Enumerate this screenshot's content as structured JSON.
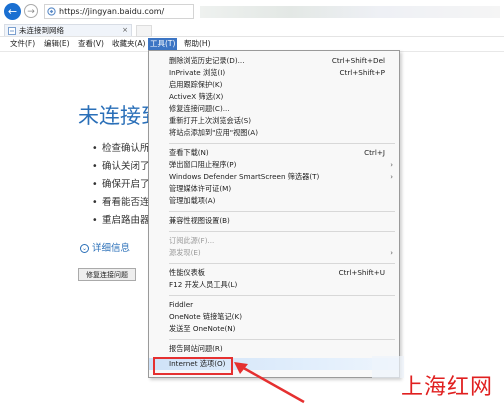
{
  "browser": {
    "url": "https://jingyan.baidu.com/",
    "tab_label": "未连接到网络",
    "tab_close": "×",
    "back_glyph": "←",
    "forward_glyph": "→"
  },
  "menubar": {
    "items": [
      {
        "label": "文件(F)"
      },
      {
        "label": "编辑(E)"
      },
      {
        "label": "查看(V)"
      },
      {
        "label": "收藏夹(A)"
      },
      {
        "label": "工具(T)"
      },
      {
        "label": "帮助(H)"
      }
    ]
  },
  "page": {
    "title": "未连接到",
    "bullets": [
      "检查确认所",
      "确认关闭了",
      "确保开启了",
      "看看能否连",
      "重启路由器"
    ],
    "details_icon": "⌄",
    "details": "详细信息",
    "fix_button": "修复连接问题"
  },
  "tools_menu": {
    "items": [
      {
        "label": "删除浏览历史记录(D)...",
        "shortcut": "Ctrl+Shift+Del"
      },
      {
        "label": "InPrivate 浏览(I)",
        "shortcut": "Ctrl+Shift+P"
      },
      {
        "label": "启用跟踪保护(K)"
      },
      {
        "label": "ActiveX 筛选(X)"
      },
      {
        "label": "修复连接问题(C)..."
      },
      {
        "label": "重新打开上次浏览会话(S)"
      },
      {
        "label": "将站点添加到\"应用\"视图(A)"
      },
      {
        "label": "查看下载(N)",
        "shortcut": "Ctrl+J"
      },
      {
        "label": "弹出窗口阻止程序(P)",
        "arrow": "›"
      },
      {
        "label": "Windows Defender SmartScreen 筛选器(T)",
        "arrow": "›"
      },
      {
        "label": "管理媒体许可证(M)"
      },
      {
        "label": "管理加载项(A)"
      },
      {
        "label": "兼容性视图设置(B)"
      },
      {
        "label": "订阅此源(F)..."
      },
      {
        "label": "源发现(E)",
        "arrow": "›"
      },
      {
        "label": "性能仪表板",
        "shortcut": "Ctrl+Shift+U"
      },
      {
        "label": "F12 开发人员工具(L)"
      },
      {
        "label": "Fiddler"
      },
      {
        "label": "OneNote 链接笔记(K)"
      },
      {
        "label": "发送至 OneNote(N)"
      },
      {
        "label": "报告网站问题(R)"
      },
      {
        "label": "Internet 选项(O)"
      }
    ]
  },
  "watermark": "上海红网",
  "colors": {
    "accent": "#2a6fb8",
    "menu_active": "#3c75c4",
    "highlight_box": "#e53030"
  }
}
